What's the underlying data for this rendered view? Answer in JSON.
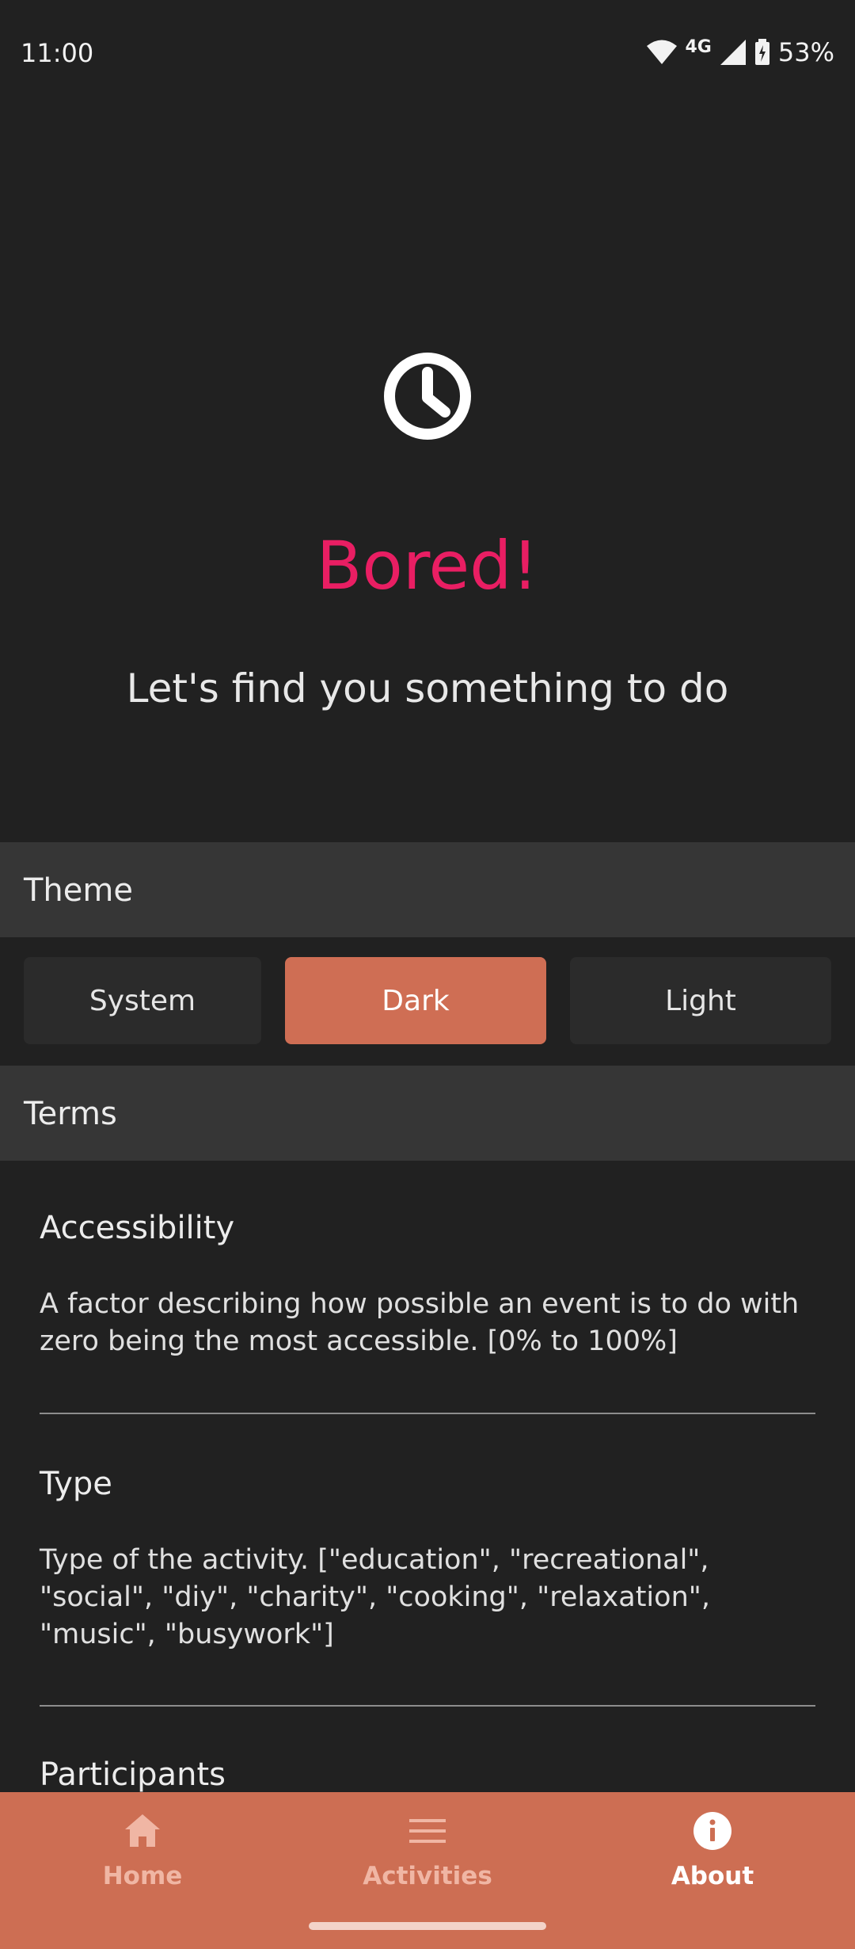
{
  "status": {
    "time": "11:00",
    "network": "4G",
    "battery": "53%"
  },
  "hero": {
    "icon": "clock-icon",
    "title": "Bored!",
    "subtitle": "Let's find you something to do",
    "title_color": "#e91e63"
  },
  "theme_section": {
    "header": "Theme",
    "options": [
      "System",
      "Dark",
      "Light"
    ],
    "selected": "Dark",
    "accent_color": "#cf6e54"
  },
  "terms_section": {
    "header": "Terms",
    "items": [
      {
        "title": "Accessibility",
        "description": "A factor describing how possible an event is to do with zero being the most accessible. [0% to 100%]"
      },
      {
        "title": "Type",
        "description": "Type of the activity. [\"education\", \"recreational\", \"social\", \"diy\", \"charity\", \"cooking\", \"relaxation\", \"music\", \"busywork\"]"
      },
      {
        "title": "Participants"
      }
    ]
  },
  "bottom_nav": {
    "items": [
      {
        "label": "Home",
        "icon": "home-icon"
      },
      {
        "label": "Activities",
        "icon": "menu-icon"
      },
      {
        "label": "About",
        "icon": "info-icon"
      }
    ],
    "active": "About",
    "background": "#cd6e53"
  }
}
